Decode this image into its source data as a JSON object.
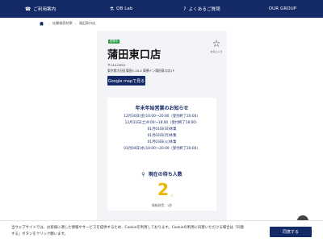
{
  "nav": [
    {
      "icon": "help-icon",
      "glyph": "☎",
      "label": "ご利用案内"
    },
    {
      "icon": "lab-icon",
      "glyph": "⚗",
      "label": "QB Lab"
    },
    {
      "icon": "question-icon",
      "glyph": "?",
      "label": "よくあるご質問"
    },
    {
      "icon": "",
      "glyph": "",
      "label": "OUR GROUP"
    }
  ],
  "breadcrumb": {
    "section": "店舗検索結果",
    "current": "蒲田東口店"
  },
  "store": {
    "tag": "営業中",
    "name": "蒲田東口店",
    "favorite_label": "お気に入り",
    "zip": "〒144-0052",
    "address": "東京都大田区蒲田5-18-4 東横イン蒲田東口店1F",
    "map_button": "Google mapで見る"
  },
  "notice": {
    "title": "年末年始営業のお知らせ",
    "lines": [
      "12月30日(金)10:00〜20:00（受付終了20:00）",
      "12月31日(土)9:00〜18:00（受付終了18:00）",
      "01月01日(日)休業",
      "01月02日(月)休業",
      "01月03日(火)休業",
      "01月04日(水)10:00〜20:00（受付終了20:00）"
    ]
  },
  "wait": {
    "title": "現在の待ち人数",
    "count": "2",
    "unit": "人",
    "note": "情報取得：1秒"
  },
  "cookie": {
    "text": "当ウェブサイトでは、お客様に適した情報やサービスを提供するため、Cookieを利用しております。Cookieの利用に同意いただける場合は「同意する」ボタンをクリック願います。",
    "button": "同意する"
  }
}
